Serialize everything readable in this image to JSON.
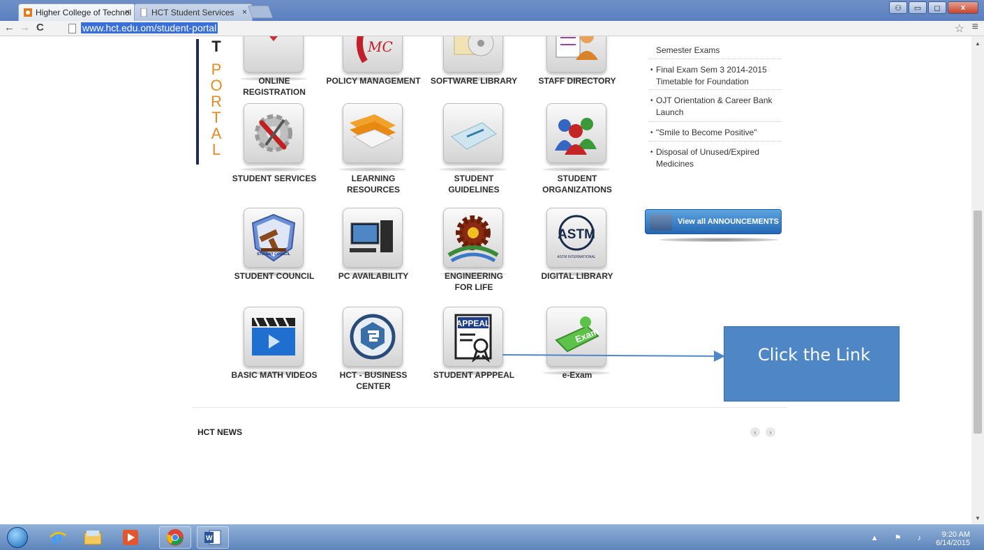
{
  "browser": {
    "tabs": [
      {
        "title": "Higher College of Technol",
        "active": true
      },
      {
        "title": "HCT Student Services",
        "active": false
      }
    ],
    "tab_close": "×",
    "url": "www.hct.edu.om/student-portal",
    "window_buttons": {
      "minimize": "▭",
      "maximize": "◻",
      "close": "x"
    }
  },
  "portal_letters": [
    "T",
    "P",
    "O",
    "R",
    "T",
    "A",
    "L"
  ],
  "tiles": [
    {
      "id": "online-registration",
      "label": "ONLINE REGISTRATION",
      "icon": "registration-icon"
    },
    {
      "id": "policy-management",
      "label": "POLICY MANAGEMENT",
      "icon": "policy-icon"
    },
    {
      "id": "software-library",
      "label": "SOFTWARE LIBRARY",
      "icon": "software-disc-icon"
    },
    {
      "id": "staff-directory",
      "label": "STAFF DIRECTORY",
      "icon": "directory-icon"
    },
    {
      "id": "student-services",
      "label": "STUDENT SERVICES",
      "icon": "gear-tools-icon"
    },
    {
      "id": "learning-resources",
      "label": "LEARNING RESOURCES",
      "icon": "folder-books-icon"
    },
    {
      "id": "student-guidelines",
      "label": "STUDENT GUIDELINES",
      "icon": "guidelines-book-icon"
    },
    {
      "id": "student-organizations",
      "label": "STUDENT ORGANIZATIONS",
      "icon": "people-group-icon"
    },
    {
      "id": "student-council",
      "label": "STUDENT COUNCIL",
      "icon": "gavel-badge-icon"
    },
    {
      "id": "pc-availability",
      "label": "PC AVAILABILITY",
      "icon": "desktop-computer-icon"
    },
    {
      "id": "engineering-for-life",
      "label": "ENGINEERING FOR LIFE",
      "icon": "gear-sun-icon"
    },
    {
      "id": "digital-library",
      "label": "DIGITAL LIBRARY",
      "icon": "astm-logo-icon"
    },
    {
      "id": "basic-math-videos",
      "label": "BASIC MATH VIDEOS",
      "icon": "video-clapper-icon"
    },
    {
      "id": "hct-business-center",
      "label": "HCT - BUSINESS CENTER",
      "icon": "business-center-logo-icon"
    },
    {
      "id": "student-apppeal",
      "label": "STUDENT APPPEAL",
      "icon": "appeal-document-icon"
    },
    {
      "id": "e-exam",
      "label": "e-Exam",
      "icon": "exam-key-icon"
    }
  ],
  "tile_icon_text": {
    "policy": "MC",
    "astm": "ASTM",
    "astm_sub": "ASTM INTERNATIONAL",
    "appeal": "APPEAL",
    "exam": "Exam",
    "council": "STUDENT COUNCIL"
  },
  "announcements": [
    "Semester Exams",
    "Final Exam Sem 3 2014-2015 Timetable for Foundation",
    "OJT Orientation & Career Bank Launch",
    "\"Smile to Become Positive\"",
    "Disposal of Unused/Expired Medicines"
  ],
  "view_all_label": "View all ANNOUNCEMENTS",
  "news_title": "HCT NEWS",
  "news_prev": "‹",
  "news_next": "›",
  "callout_text": "Click the Link",
  "taskbar": {
    "time": "9:20 AM",
    "date": "6/14/2015"
  }
}
